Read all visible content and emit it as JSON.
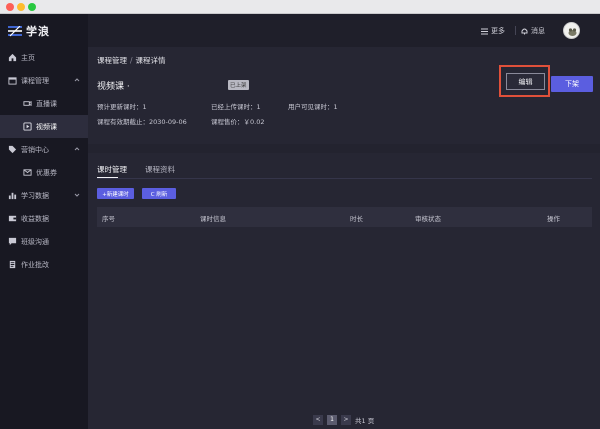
{
  "app": {
    "name": "学浪"
  },
  "sidebar": {
    "items": [
      {
        "label": "主页",
        "icon": "home-icon"
      },
      {
        "label": "课程管理",
        "icon": "calendar-icon",
        "expanded": true
      },
      {
        "label": "直播课",
        "icon": "video-camera-icon"
      },
      {
        "label": "视频课",
        "icon": "play-icon",
        "active": true
      },
      {
        "label": "营销中心",
        "icon": "tag-icon",
        "expanded": true
      },
      {
        "label": "优惠券",
        "icon": "mail-icon"
      },
      {
        "label": "学习数据",
        "icon": "bar-chart-icon",
        "expanded": false
      },
      {
        "label": "收益数据",
        "icon": "wallet-icon"
      },
      {
        "label": "班级沟通",
        "icon": "chat-icon"
      },
      {
        "label": "作业批改",
        "icon": "document-icon"
      }
    ]
  },
  "header": {
    "more_label": "更多",
    "msg_label": "消息"
  },
  "breadcrumb": {
    "first": "课程管理",
    "separator": "/",
    "second": "课程详情"
  },
  "course": {
    "title": "视频课 ·",
    "status_badge": "已上架",
    "planned_lessons": "预计更新课时：1",
    "uploaded_lessons": "已经上传课时：1",
    "visible_lessons": "用户可见课时：1",
    "expiry": "课程有效期截止：2030-09-06",
    "price": "课程售价：￥0.02"
  },
  "actions": {
    "edit_label": "编辑",
    "offline_label": "下架"
  },
  "tabs": [
    {
      "label": "课时管理",
      "active": true
    },
    {
      "label": "课程资料",
      "active": false
    }
  ],
  "toolbar": {
    "new_label": "+新建课时",
    "refresh_label": "C 刷新"
  },
  "table": {
    "columns": [
      "序号",
      "课时信息",
      "时长",
      "审核状态",
      "操作"
    ]
  },
  "pagination": {
    "prev": "<",
    "current": "1",
    "next": ">",
    "total_label": "共1 页"
  },
  "colors": {
    "accent": "#5b5ee0",
    "highlight": "#e0503a"
  }
}
